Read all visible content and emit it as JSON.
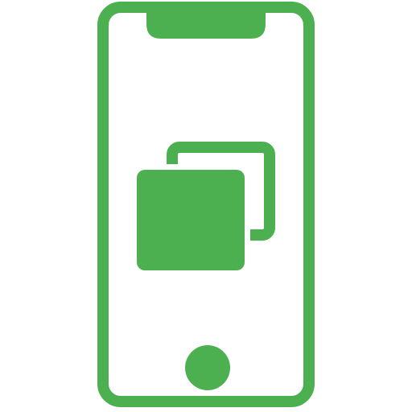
{
  "icon": {
    "name": "phone-app-switch-icon",
    "color": "#4CAF50",
    "background": "#FFFFFF",
    "parts": [
      "phone-outline",
      "notch",
      "home-button",
      "back-window",
      "front-window"
    ]
  }
}
